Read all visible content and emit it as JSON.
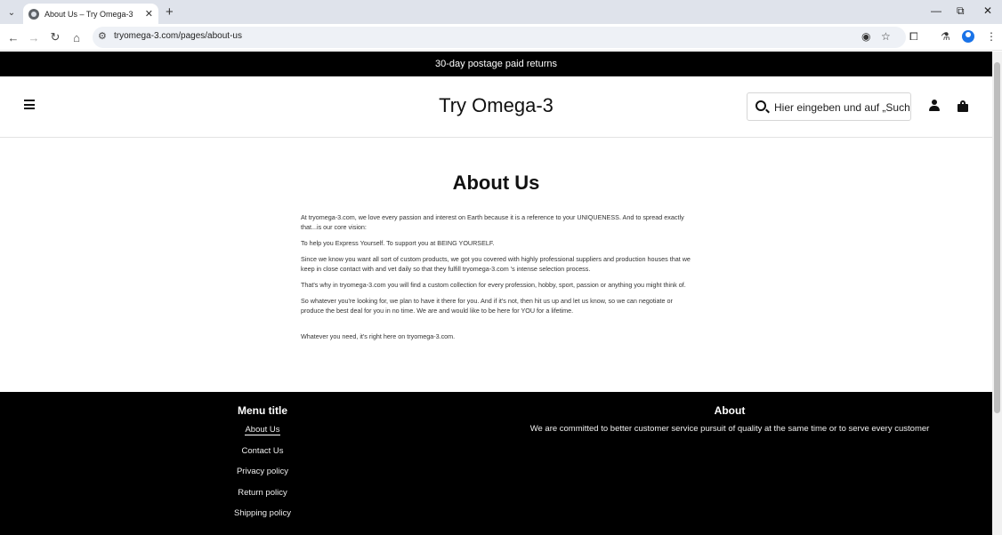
{
  "browser": {
    "tab_title": "About Us – Try Omega-3",
    "url": "tryomega-3.com/pages/about-us"
  },
  "announcement": "30-day postage paid returns",
  "header": {
    "logo": "Try Omega-3",
    "search_placeholder": "Hier eingeben und auf „Suchen“ klicken"
  },
  "page": {
    "title": "About Us",
    "paragraphs": [
      "At tryomega-3.com, we love every passion and interest on Earth because it is a reference to your UNIQUENESS. And to spread exactly that...is our core vision:",
      "To help you Express Yourself. To support you at BEING YOURSELF.",
      "Since we know you want all sort of custom products, we got you covered with highly professional suppliers and production houses that we keep in close contact with and vet daily so that they fulfill tryomega-3.com 's intense selection process.",
      "That's why in tryomega-3.com you will find a custom collection for every profession, hobby, sport, passion or anything you might think of.",
      "So whatever you're looking for, we plan to have it there for you. And if it's not, then hit us up and let us know, so we can negotiate or produce the best deal for you in no time. We are and would like to be here for YOU for a lifetime.",
      "Whatever you need, it's right here on tryomega-3.com."
    ]
  },
  "footer": {
    "menu_title": "Menu title",
    "links": [
      "About Us",
      "Contact Us",
      "Privacy policy",
      "Return policy",
      "Shipping policy"
    ],
    "about_title": "About",
    "about_text": "We are committed to better customer service pursuit of quality at the same time or to serve every customer"
  }
}
